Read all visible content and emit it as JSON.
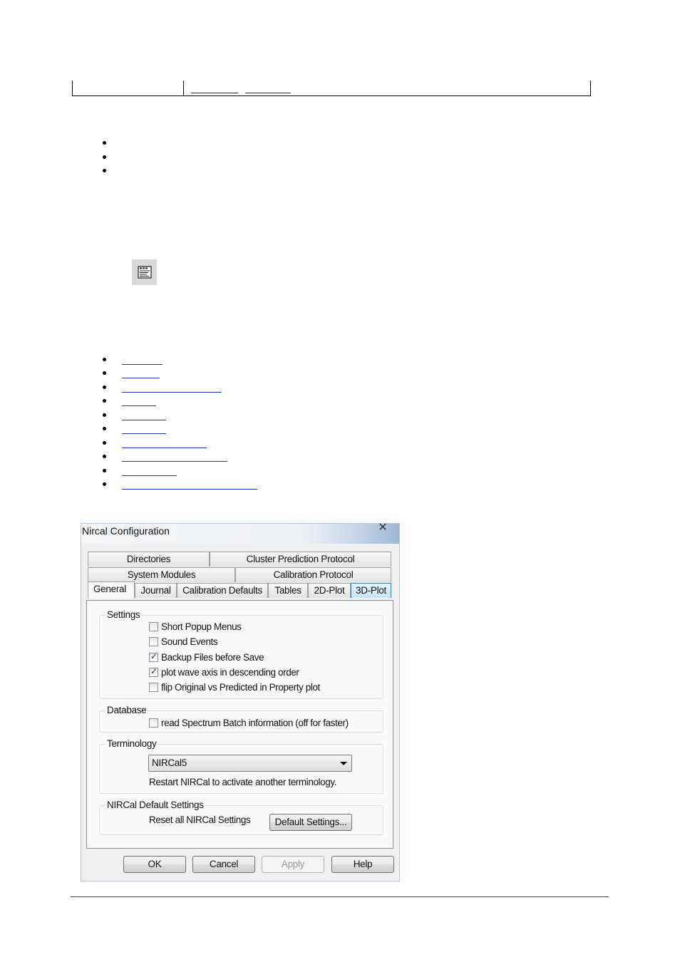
{
  "dialog": {
    "title": "Nircal Configuration",
    "close_glyph": "✕",
    "tabs_row1": [
      "Directories",
      "Cluster Prediction Protocol"
    ],
    "tabs_row2": [
      "System Modules",
      "Calibration Protocol"
    ],
    "tabs_row3": [
      "General",
      "Journal",
      "Calibration Defaults",
      "Tables",
      "2D-Plot",
      "3D-Plot"
    ],
    "selected_tab": "General",
    "settings": {
      "label": "Settings",
      "options": [
        {
          "label": "Short Popup Menus",
          "checked": false
        },
        {
          "label": "Sound Events",
          "checked": false
        },
        {
          "label": "Backup Files before Save",
          "checked": true
        },
        {
          "label": "plot wave axis in descending order",
          "checked": true
        },
        {
          "label": "flip Original vs Predicted in Property plot",
          "checked": false
        }
      ]
    },
    "database": {
      "label": "Database",
      "option": {
        "label": "read Spectrum Batch information (off for faster)",
        "checked": false
      }
    },
    "terminology": {
      "label": "Terminology",
      "selected": "NIRCal5",
      "note": "Restart NIRCal to activate another terminology."
    },
    "defaults": {
      "label": "NIRCal Default Settings",
      "text": "Reset all NIRCal Settings",
      "button": "Default Settings..."
    },
    "buttons": {
      "ok": "OK",
      "cancel": "Cancel",
      "apply": "Apply",
      "help": "Help"
    }
  },
  "icons": {
    "toolbar": "configuration-icon"
  },
  "colors": {
    "link": "#1a33cc",
    "hot_tab": "#c8e4f8"
  }
}
